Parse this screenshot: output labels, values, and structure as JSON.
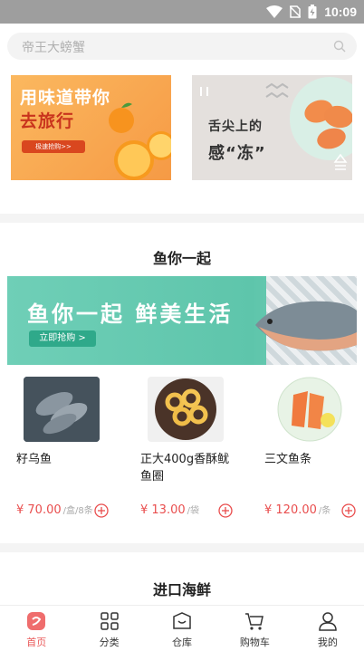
{
  "status": {
    "time": "10:09",
    "icons": [
      "wifi-icon",
      "no-sim-icon",
      "battery-charging-icon"
    ]
  },
  "search": {
    "placeholder": "帝王大螃蟹"
  },
  "banners": {
    "left": {
      "line1": "用味道带你",
      "line2": "去旅行",
      "button": "极速抢购>>"
    },
    "right": {
      "line1": "舌尖上的",
      "line2": "感“冻”"
    }
  },
  "section1": {
    "title": "鱼你一起",
    "banner": {
      "title": "鱼你一起 鲜美生活",
      "button": "立即抢购 >"
    },
    "products": [
      {
        "name": "籽乌鱼",
        "price": "¥ 70.00",
        "unit": "/盒/8条"
      },
      {
        "name": "正大400g香酥鱿鱼圈",
        "price": "¥ 13.00",
        "unit": "/袋"
      },
      {
        "name": "三文鱼条",
        "price": "¥ 120.00",
        "unit": "/条"
      }
    ]
  },
  "section2": {
    "title": "进口海鲜"
  },
  "nav": [
    {
      "label": "首页",
      "icon": "home-icon",
      "active": true
    },
    {
      "label": "分类",
      "icon": "category-grid-icon",
      "active": false
    },
    {
      "label": "仓库",
      "icon": "warehouse-box-icon",
      "active": false
    },
    {
      "label": "购物车",
      "icon": "cart-icon",
      "active": false
    },
    {
      "label": "我的",
      "icon": "user-icon",
      "active": false
    }
  ],
  "colors": {
    "accent": "#ea5a5a",
    "banner_green": "#6fcfb7",
    "banner_orange": "#f69a45"
  }
}
